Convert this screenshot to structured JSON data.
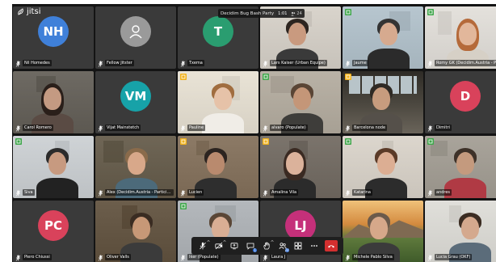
{
  "app": {
    "brand": "jitsi"
  },
  "meeting": {
    "title": "Decidim Bug Bash Party",
    "timer": "1:01",
    "participant_count": "24"
  },
  "participants": [
    {
      "id": "nh",
      "name": "Nil Homedes",
      "type": "avatar",
      "initials": "NH",
      "color": "#3f80d9",
      "row": 0,
      "col": 0
    },
    {
      "id": "fj",
      "name": "Fellow Jitster",
      "type": "avatar",
      "icon": "user-icon",
      "color": "#9a9a9a",
      "row": 0,
      "col": 1
    },
    {
      "id": "tv",
      "name": "Txema",
      "type": "avatar",
      "initials": "T",
      "color": "#2a9d70",
      "row": 0,
      "col": 2
    },
    {
      "id": "lk",
      "name": "Lars Kaiser (Urban Equipe)",
      "type": "video",
      "row": 0,
      "col": 3,
      "bg": "#d9d4cc",
      "skin": "#c99a7f",
      "hair": "#2d2520",
      "shirt": "#3a3a3a"
    },
    {
      "id": "jm",
      "name": "Jaume",
      "type": "video",
      "row": 0,
      "col": 4,
      "bg": "#b7c6cf",
      "skin": "#d6aa8f",
      "hair": "#333",
      "shirt": "#2b2b2b",
      "badge": "green"
    },
    {
      "id": "rg",
      "name": "Romy GK (Decidim.Austria - Participatio...",
      "type": "video",
      "row": 0,
      "col": 5,
      "bg": "#e4e1dc",
      "skin": "#e2b79b",
      "hair": "#b56a3a",
      "shirt": "#d6d0c6",
      "badge": "green"
    },
    {
      "id": "cr",
      "name": "Carol Romero",
      "type": "video",
      "row": 1,
      "col": 0,
      "bg": "#6e6a63",
      "skin": "#c49a82",
      "hair": "#2a1f1a",
      "shirt": "#5a4b44"
    },
    {
      "id": "vm",
      "name": "Vijat Mainstetch",
      "type": "avatar",
      "initials": "VM",
      "color": "#17a2a8",
      "row": 1,
      "col": 1
    },
    {
      "id": "pa",
      "name": "Pauline",
      "type": "video",
      "row": 1,
      "col": 2,
      "bg": "#e9e3d6",
      "skin": "#e6c2a8",
      "hair": "#a06d3f",
      "shirt": "#f0ede7",
      "active": true,
      "badge": "yellow"
    },
    {
      "id": "ap",
      "name": "alvaro (Populate)",
      "type": "video",
      "row": 1,
      "col": 3,
      "bg": "#b9b2a6",
      "skin": "#c49678",
      "hair": "#5a4535",
      "shirt": "#3e3d3a",
      "badge": "green"
    },
    {
      "id": "bn",
      "name": "Barcelona node",
      "type": "video",
      "row": 1,
      "col": 4,
      "bg": "#3c3830",
      "skin": "#c79c7e",
      "hair": "#2f2a24",
      "shirt": "#55504a",
      "badge": "yellow",
      "office": true
    },
    {
      "id": "dm",
      "name": "Dimitri",
      "type": "avatar",
      "initials": "D",
      "color": "#d9425b",
      "row": 1,
      "col": 5
    },
    {
      "id": "sl",
      "name": "Siva",
      "type": "video",
      "row": 2,
      "col": 0,
      "bg": "#cfd3d6",
      "skin": "#c79a80",
      "hair": "#2b2b2b",
      "shirt": "#222",
      "badge": "green"
    },
    {
      "id": "ad",
      "name": "Alex (Decidim.Austria - Participationsho...",
      "type": "video",
      "row": 2,
      "col": 1,
      "bg": "#6f6656",
      "skin": "#d8a88a",
      "hair": "#8a6b4b",
      "shirt": "#4c6a7a"
    },
    {
      "id": "lu",
      "name": "Lucien",
      "type": "video",
      "row": 2,
      "col": 2,
      "bg": "#8c7a66",
      "skin": "#b98a6e",
      "hair": "#2c2420",
      "shirt": "#2e2e2e",
      "badge": "yellow"
    },
    {
      "id": "av",
      "name": "Amalina Vila",
      "type": "video",
      "row": 2,
      "col": 3,
      "bg": "#7b746c",
      "skin": "#dbb29b",
      "hair": "#3a2a22",
      "shirt": "#2b2b2b",
      "badge": "yellow"
    },
    {
      "id": "kt",
      "name": "Katarina",
      "type": "video",
      "row": 2,
      "col": 4,
      "bg": "#dcd6cd",
      "skin": "#dcae93",
      "hair": "#5b3b28",
      "shirt": "#2c2c2c",
      "badge": "green"
    },
    {
      "id": "an",
      "name": "andres",
      "type": "video",
      "row": 2,
      "col": 5,
      "bg": "#a9a49b",
      "skin": "#c49a7e",
      "hair": "#3d3128",
      "shirt": "#b03a44",
      "badge": "green"
    },
    {
      "id": "pc",
      "name": "Piero Chiussi",
      "type": "avatar",
      "initials": "PC",
      "color": "#d9425b",
      "row": 3,
      "col": 0
    },
    {
      "id": "ov",
      "name": "Oliver Valls",
      "type": "video",
      "row": 3,
      "col": 1,
      "bg": "#6c5e4c",
      "skin": "#c79877",
      "hair": "#3a2c22",
      "shirt": "#3b3b3b"
    },
    {
      "id": "ip",
      "name": "Iker (Populate)",
      "type": "video",
      "row": 3,
      "col": 2,
      "bg": "#b4b8bc",
      "skin": "#d9ae94",
      "hair": "#5a4636",
      "shirt": "#2a2a2a",
      "badge": "green"
    },
    {
      "id": "lj",
      "name": "Laura J",
      "type": "avatar",
      "initials": "LJ",
      "color": "#c5307a",
      "row": 3,
      "col": 3
    },
    {
      "id": "ms",
      "name": "Michele Pablo Silva",
      "type": "video",
      "row": 3,
      "col": 4,
      "bg": "#c48f4f",
      "skin": "#d6a88a",
      "hair": "#6b5a4b",
      "shirt": "#3b3b3b",
      "landscape": true
    },
    {
      "id": "lg",
      "name": "Lucia Grau (OKF)",
      "type": "video",
      "row": 3,
      "col": 5,
      "bg": "#e0dfda",
      "skin": "#d4a98e",
      "hair": "#3b2c22",
      "shirt": "#5b6c7a"
    }
  ],
  "toolbar": {
    "buttons": [
      {
        "name": "mic-button",
        "icon": "mic-icon",
        "has_caret": true
      },
      {
        "name": "camera-button",
        "icon": "camera-icon",
        "has_caret": true
      },
      {
        "name": "share-screen-button",
        "icon": "screen-share-icon"
      },
      {
        "name": "chat-button",
        "icon": "chat-icon",
        "badge": "1"
      },
      {
        "name": "raise-hand-button",
        "icon": "hand-icon",
        "has_caret": true
      },
      {
        "name": "participants-button",
        "icon": "participants-icon",
        "badge": "24"
      },
      {
        "name": "tile-view-button",
        "icon": "grid-icon"
      },
      {
        "name": "more-button",
        "icon": "more-icon"
      },
      {
        "name": "hangup-button",
        "icon": "hangup-icon"
      }
    ]
  },
  "colors": {
    "badge_green": "#3fa64b",
    "badge_yellow": "#f1b11a",
    "active_border": "#4a8fe0",
    "hangup": "#d32f2f"
  }
}
